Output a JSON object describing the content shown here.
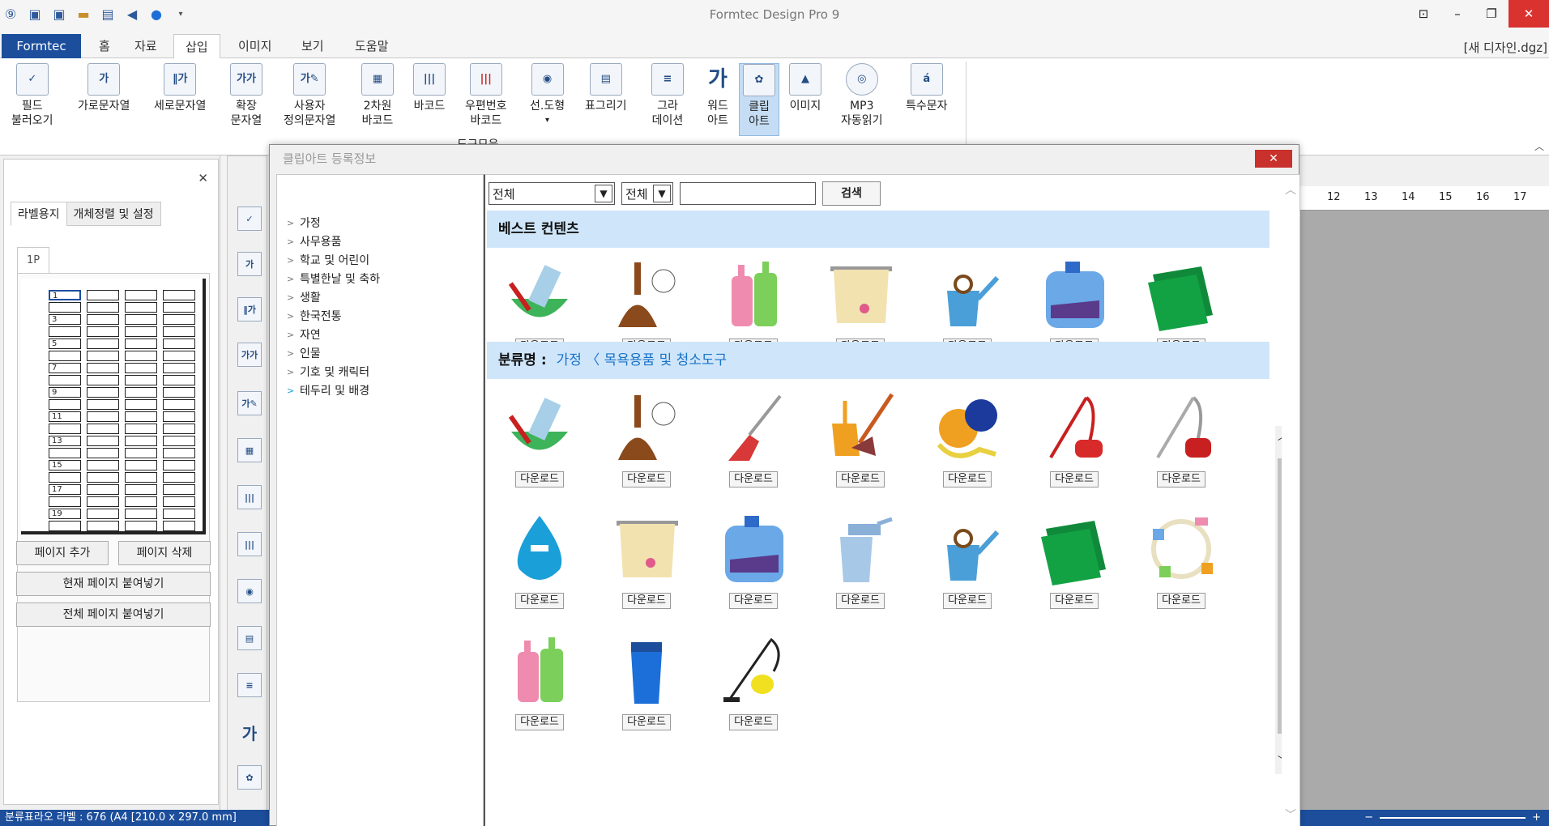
{
  "app": {
    "title": "Formtec Design Pro 9",
    "doc_name": "[새 디자인.dgz]"
  },
  "ribbon_tabs": [
    "Formtec",
    "홈",
    "자료",
    "삽입",
    "이미지",
    "보기",
    "도움말"
  ],
  "ribbon_buttons": [
    {
      "label": "필드\n불러오기",
      "icon": "field-icon"
    },
    {
      "label": "가로문자열",
      "icon": "horizontal-text-icon"
    },
    {
      "label": "세로문자열",
      "icon": "vertical-text-icon"
    },
    {
      "label": "확장\n문자열",
      "icon": "extended-text-icon"
    },
    {
      "label": "사용자\n정의문자열",
      "icon": "custom-text-icon"
    },
    {
      "label": "2차원\n바코드",
      "icon": "qr-icon"
    },
    {
      "label": "바코드",
      "icon": "barcode-icon"
    },
    {
      "label": "우편번호\n바코드",
      "icon": "postal-barcode-icon"
    },
    {
      "label": "선.도형",
      "icon": "shape-icon"
    },
    {
      "label": "표그리기",
      "icon": "table-icon"
    },
    {
      "label": "그라\n데이션",
      "icon": "gradient-icon"
    },
    {
      "label": "워드\n아트",
      "icon": "wordart-icon"
    },
    {
      "label": "클립\n아트",
      "icon": "clipart-icon"
    },
    {
      "label": "이미지",
      "icon": "image-icon"
    },
    {
      "label": "MP3\n자동읽기",
      "icon": "mp3-icon"
    },
    {
      "label": "특수문자",
      "icon": "special-char-icon"
    }
  ],
  "ribbon_partial_text": "도구모음",
  "left_panel": {
    "tabs": [
      "라벨용지",
      "개체정렬 및 설정"
    ],
    "page_tab": "1P",
    "label_numbers": [
      "1",
      "3",
      "5",
      "7",
      "9",
      "11",
      "13",
      "15",
      "17",
      "19"
    ],
    "buttons": {
      "add_page": "페이지 추가",
      "delete_page": "페이지 삭제",
      "paste_current": "현재 페이지 붙여넣기",
      "paste_all": "전체 페이지 붙여넣기"
    }
  },
  "status": {
    "text": "분류표라오 라벨 : 676 (A4 [210.0 x 297.0 mm]"
  },
  "ruler_ticks": [
    "12",
    "13",
    "14",
    "15",
    "16",
    "17"
  ],
  "dialog": {
    "title": "클립아트 등록정보",
    "tree": [
      "가정",
      "사무용품",
      "학교 및 어린이",
      "특별한날 및 축하",
      "생활",
      "한국전통",
      "자연",
      "인물",
      "기호 및 캐릭터",
      "테두리 및 배경"
    ],
    "search": {
      "select1": "전체",
      "select2": "전체",
      "button": "검색"
    },
    "best_title": "베스트 컨텐츠",
    "category_label": "분류명 :",
    "category_path": "가정 〈 목욕용품 및 청소도구",
    "download_label": "다운로드",
    "best_items": [
      "brush-bowl-icon",
      "mop-icon",
      "soap-bottles-icon",
      "towel-icon",
      "watering-can-icon",
      "detergent-icon",
      "folders-icon"
    ],
    "category_items": [
      "brush-bowl-icon",
      "mop-icon",
      "broom-icon",
      "dustpan-icon",
      "vacuum-icon",
      "vacuum-red-icon",
      "vacuum-grey-icon",
      "faucet-drop-icon",
      "towel-icon",
      "detergent-icon",
      "spray-bottle-icon",
      "watering-can-icon",
      "folders-icon",
      "bath-set-icon",
      "soap-bottles-icon",
      "trash-can-icon",
      "steam-cleaner-icon"
    ]
  },
  "colors": {
    "accent": "#1c4e9c",
    "section_bg": "#cfe6fa",
    "close_red": "#d9322f",
    "crumb_blue": "#1a73c8"
  }
}
